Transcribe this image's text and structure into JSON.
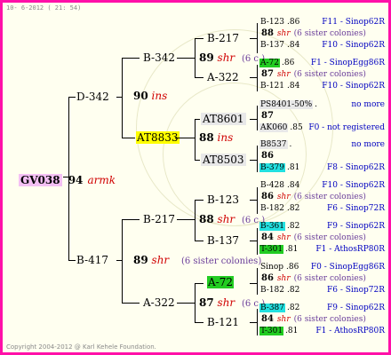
{
  "header": {
    "date": "10- 6-2012 ( 21: 54)"
  },
  "copyright": "Copyright 2004-2012 @ Karl Kehele Foundation.",
  "root": {
    "name": "GV038",
    "year": "94",
    "breeder": "armk"
  },
  "gen1": {
    "mother": {
      "name": "D-342",
      "year": "90",
      "breeder": "ins"
    },
    "father": {
      "name": "B-417",
      "year": "89",
      "breeder": "shr",
      "sisters": "(6 sister colonies)"
    }
  },
  "gen2": {
    "m_mother": {
      "name": "B-342",
      "year": "89",
      "breeder": "shr",
      "sisters": "(6 c.)"
    },
    "m_father": {
      "name": "AT8833",
      "year": "88",
      "breeder": "ins"
    },
    "f_mother": {
      "name": "B-217",
      "year": "88",
      "breeder": "shr",
      "sisters": "(6 c.)"
    },
    "f_father": {
      "name": "A-322",
      "year": "87",
      "breeder": "shr",
      "sisters": "(6 c.)"
    }
  },
  "gen3": [
    {
      "name": "B-217"
    },
    {
      "name": "A-322"
    },
    {
      "name": "AT8601"
    },
    {
      "name": "AT8503"
    },
    {
      "name": "B-123"
    },
    {
      "name": "B-137"
    },
    {
      "name": "A-72"
    },
    {
      "name": "B-121"
    }
  ],
  "gen4_groups": [
    {
      "top": {
        "name": "B-123",
        "year": ".86",
        "src": "F11 - Sinop62R"
      },
      "mid": {
        "year": "88",
        "breeder": "shr",
        "sisters": "(6 sister colonies)"
      },
      "bot": {
        "name": "B-137",
        "year": ".84",
        "src": "F10 - Sinop62R"
      }
    },
    {
      "top": {
        "name": "A-72",
        "year": ".86",
        "src": "F1 - SinopEgg86R"
      },
      "mid": {
        "year": "87",
        "breeder": "shr",
        "sisters": "(6 sister colonies)"
      },
      "bot": {
        "name": "B-121",
        "year": ".84",
        "src": "F10 - Sinop62R"
      }
    },
    {
      "top": {
        "name": "PS8401-50%",
        "year": ".",
        "src": "no more"
      },
      "mid": {
        "year": "87",
        "breeder": "",
        "sisters": ""
      },
      "bot": {
        "name": "AK060",
        "year": ".85",
        "src": "F0 - not registered"
      }
    },
    {
      "top": {
        "name": "B8537",
        "year": ".",
        "src": "no more"
      },
      "mid": {
        "year": "86",
        "breeder": "",
        "sisters": ""
      },
      "bot": {
        "name": "B-379",
        "year": ".81",
        "src": "F8 - Sinop62R"
      }
    },
    {
      "top": {
        "name": "B-428",
        "year": ".84",
        "src": "F10 - Sinop62R"
      },
      "mid": {
        "year": "86",
        "breeder": "shr",
        "sisters": "(6 sister colonies)"
      },
      "bot": {
        "name": "B-182",
        "year": ".82",
        "src": "F6 - Sinop72R"
      }
    },
    {
      "top": {
        "name": "B-361",
        "year": ".82",
        "src": "F9 - Sinop62R"
      },
      "mid": {
        "year": "84",
        "breeder": "shr",
        "sisters": "(6 sister colonies)"
      },
      "bot": {
        "name": "T-301",
        "year": ".81",
        "src": "F1 - AthosRP80R"
      }
    },
    {
      "top": {
        "name": "Sinop",
        "year": ".86",
        "src": "F0 - SinopEgg86R"
      },
      "mid": {
        "year": "86",
        "breeder": "shr",
        "sisters": "(6 sister colonies)"
      },
      "bot": {
        "name": "B-182",
        "year": ".82",
        "src": "F6 - Sinop72R"
      }
    },
    {
      "top": {
        "name": "B-387",
        "year": ".82",
        "src": "F9 - Sinop62R"
      },
      "mid": {
        "year": "84",
        "breeder": "shr",
        "sisters": "(6 sister colonies)"
      },
      "bot": {
        "name": "T-301",
        "year": ".81",
        "src": "F1 - AthosRP80R"
      }
    }
  ],
  "colors": {
    "frame": "#ff10a8",
    "breeder": "#d00000",
    "source": "#0000c0",
    "green": "#22cc22",
    "cyan": "#22e0e0",
    "yellow": "#ffff00"
  }
}
